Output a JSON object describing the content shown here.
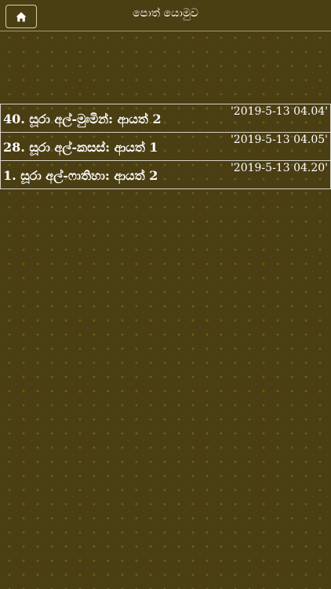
{
  "header": {
    "title": "පොත් යොමුව",
    "home_icon": "home-icon"
  },
  "colors": {
    "background": "#4a3e13",
    "text": "#ffffff",
    "border": "#d6d2c4"
  },
  "bookmarks": [
    {
      "title": "40. සූරා අල්-මුඃමින්: ආයත් 2",
      "date": "'2019-5-13 04.04'"
    },
    {
      "title": "28. සූරා අල්-කසස්: ආයත් 1",
      "date": "'2019-5-13 04.05'"
    },
    {
      "title": "1. සූරා අල්-ෆාතිහා: ආයත් 2",
      "date": "'2019-5-13 04.20'"
    }
  ]
}
